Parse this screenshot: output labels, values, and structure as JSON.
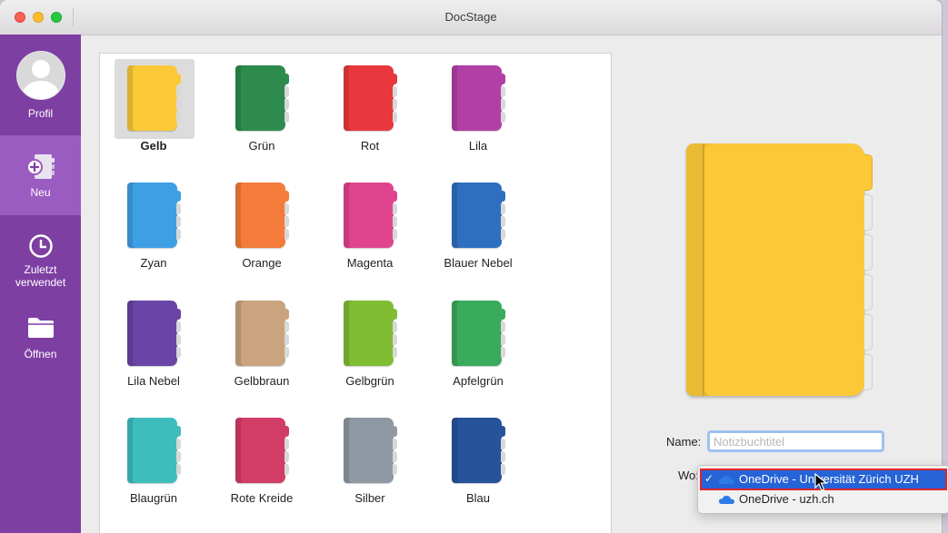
{
  "window": {
    "title": "DocStage"
  },
  "sidebar": {
    "items": [
      {
        "label": "Profil",
        "icon": "avatar"
      },
      {
        "label": "Neu",
        "icon": "new-notebook-icon"
      },
      {
        "label": "Zuletzt verwendet",
        "icon": "clock-icon"
      },
      {
        "label": "Öffnen",
        "icon": "folder-icon"
      }
    ],
    "active": "Neu",
    "background": "#7e3fa3",
    "active_background": "#9b5cc1"
  },
  "notebooks": {
    "selected": "Gelb",
    "items": [
      {
        "label": "Gelb",
        "color": "#fbc938"
      },
      {
        "label": "Grün",
        "color": "#2e8b4e"
      },
      {
        "label": "Rot",
        "color": "#e8383d"
      },
      {
        "label": "Lila",
        "color": "#b23fa6"
      },
      {
        "label": "Zyan",
        "color": "#3f9fe4"
      },
      {
        "label": "Orange",
        "color": "#f47b3a"
      },
      {
        "label": "Magenta",
        "color": "#e1448f"
      },
      {
        "label": "Blauer Nebel",
        "color": "#2f6fbf"
      },
      {
        "label": "Lila Nebel",
        "color": "#6a44a6"
      },
      {
        "label": "Gelbbraun",
        "color": "#c9a47f"
      },
      {
        "label": "Gelbgrün",
        "color": "#80bd33"
      },
      {
        "label": "Apfelgrün",
        "color": "#3aab5d"
      },
      {
        "label": "Blaugrün",
        "color": "#3fbdbd"
      },
      {
        "label": "Rote Kreide",
        "color": "#d13d67"
      },
      {
        "label": "Silber",
        "color": "#8f99a3"
      },
      {
        "label": "Blau",
        "color": "#27539a"
      }
    ]
  },
  "form": {
    "name_label": "Name:",
    "name_placeholder": "Notizbuchtitel",
    "name_value": "",
    "where_label": "Wo:"
  },
  "location_menu": {
    "options": [
      {
        "label": "OneDrive - Universität Zürich UZH",
        "checked": true,
        "check": "✓"
      },
      {
        "label": "OneDrive - uzh.ch",
        "checked": false,
        "check": ""
      }
    ],
    "cloud_color": "#2d7be5"
  }
}
